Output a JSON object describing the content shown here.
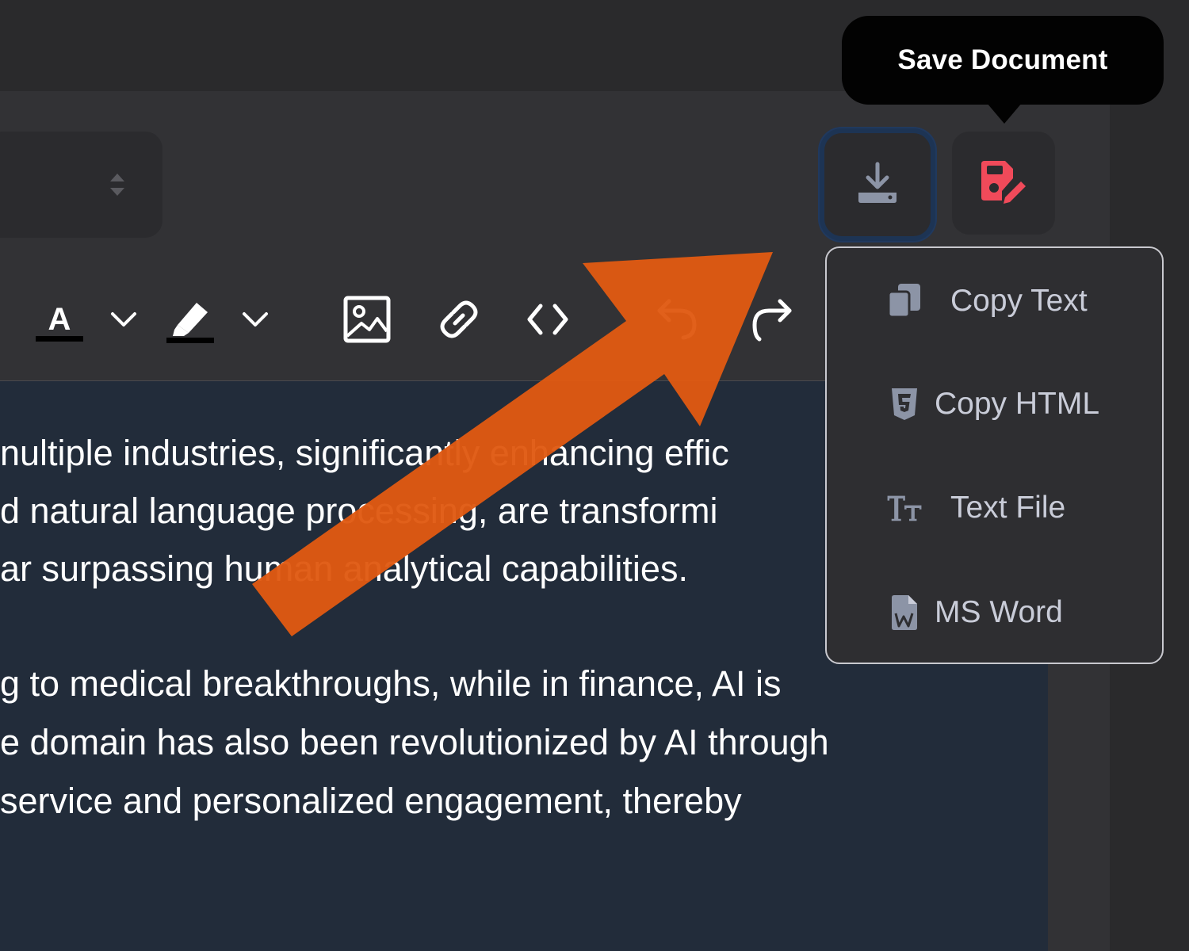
{
  "tooltip": {
    "text": "Save Document"
  },
  "header_buttons": [
    {
      "name": "download",
      "icon": "download-icon",
      "color": "#8c94a6",
      "border": "#20395e"
    },
    {
      "name": "save-document",
      "icon": "save-edit-icon",
      "color": "#f04a5a"
    }
  ],
  "toolbar": {
    "items": [
      "text-color-icon",
      "chevron-down-icon",
      "highlighter-icon",
      "chevron-down-icon",
      "image-icon",
      "link-icon",
      "code-icon",
      "undo-icon",
      "redo-icon"
    ]
  },
  "editor": {
    "lines": [
      "nultiple industries, significantly enhancing effic",
      "d natural language processing, are transformi",
      "ar surpassing human analytical capabilities.",
      "g to medical breakthroughs, while in finance, AI is",
      "e domain has also been revolutionized by AI through",
      "service and personalized engagement, thereby"
    ]
  },
  "download_menu": {
    "items": [
      {
        "icon": "copy-icon",
        "label": "Copy Text"
      },
      {
        "icon": "html5-icon",
        "label": "Copy HTML"
      },
      {
        "icon": "text-format-icon",
        "label": "Text File"
      },
      {
        "icon": "word-file-icon",
        "label": "MS Word"
      }
    ]
  },
  "annotation": {
    "arrow_color": "#e05a12"
  }
}
